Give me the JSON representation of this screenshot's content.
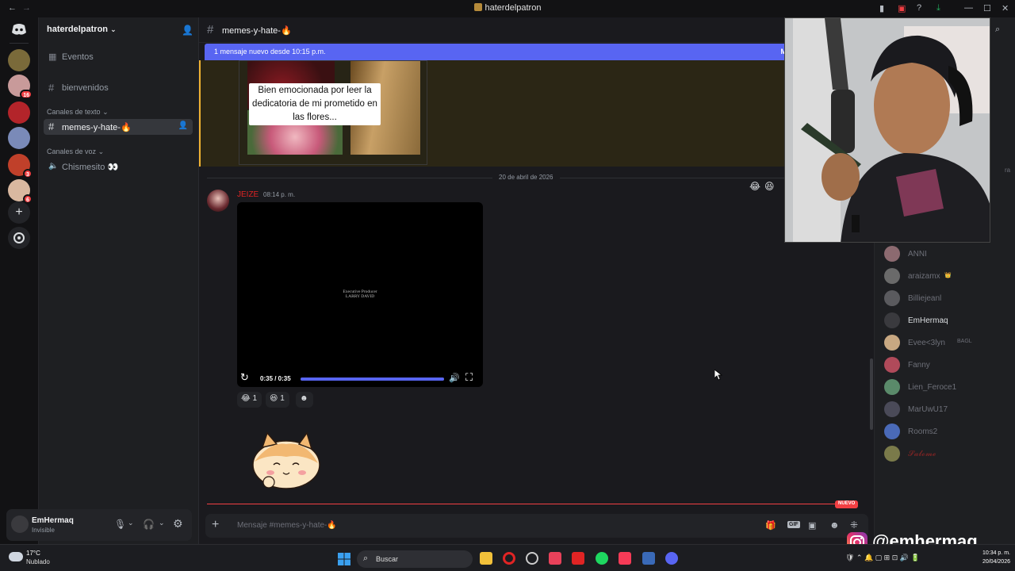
{
  "window": {
    "title": "haterdelpatron"
  },
  "server": {
    "name": "haterdelpatron"
  },
  "sidebar": {
    "events_label": "Eventos",
    "channels_top": [
      {
        "label": "bienvenidos"
      }
    ],
    "text_category": "Canales de texto",
    "text_channels": [
      {
        "label": "memes-y-hate-🔥",
        "active": true
      }
    ],
    "voice_category": "Canales de voz",
    "voice_channels": [
      {
        "label": "Chismesito 👀"
      }
    ]
  },
  "servers": [
    {
      "color": "#7a6a3a",
      "badge": ""
    },
    {
      "color": "#c89a9a",
      "badge": "16"
    },
    {
      "color": "#b3242a",
      "badge": ""
    },
    {
      "color": "#7a8ab8",
      "badge": ""
    },
    {
      "color": "#c0402a",
      "badge": "3"
    },
    {
      "color": "#d9b8a0",
      "badge": "6"
    }
  ],
  "channel": {
    "name": "memes-y-hate-🔥",
    "new_messages_bar": "1 mensaje nuevo desde 10:15 p.m.",
    "new_messages_bar_right": "M"
  },
  "meme": {
    "caption": "Bien emocionada por leer la dedicatoria de mi prometido en las flores..."
  },
  "date_divider": "20 de abril de 2026",
  "message": {
    "author": "JEIZE",
    "author_color": "#e02424",
    "time": "08:14 p. m.",
    "video": {
      "overlay_line1": "Executive Producer",
      "overlay_line2": "LARRY DAVID",
      "time_display": "0:35 / 0:35",
      "progress": 1.0
    },
    "reactions": [
      {
        "emoji": "😂",
        "count": "1"
      },
      {
        "emoji": "😆",
        "count": "1"
      }
    ]
  },
  "new_label": "NUEVO",
  "composer": {
    "placeholder": "Mensaje #memes-y-hate-🔥"
  },
  "user_panel": {
    "name": "EmHermaq",
    "status": "Invisible"
  },
  "members": [
    {
      "name": "ANNI",
      "color": "#8c6a70",
      "extra": ""
    },
    {
      "name": "araizamx",
      "color": "#6a6a6a",
      "extra": "👑"
    },
    {
      "name": "Billiejeanl",
      "color": "#5a5a5e",
      "extra": ""
    },
    {
      "name": "EmHermaq",
      "color": "#3a3a3e",
      "extra": "",
      "active": true
    },
    {
      "name": "Evee<3lyn",
      "color": "#c8a882",
      "extra": "BAGL"
    },
    {
      "name": "Fanny",
      "color": "#b04a5a",
      "extra": ""
    },
    {
      "name": "Lien_Feroce1",
      "color": "#5a8a6a",
      "extra": ""
    },
    {
      "name": "MarUwU17",
      "color": "#4a4a58",
      "extra": ""
    },
    {
      "name": "Rooms2",
      "color": "#4a6ab8",
      "extra": ""
    },
    {
      "name": "𝓢𝓪𝓵𝓸𝓶𝓮",
      "color": "#7a7a4a",
      "extra": "",
      "red": true
    }
  ],
  "members_partial_label": "ra",
  "overlay": {
    "handle": "@emhermaq"
  },
  "taskbar": {
    "weather_temp": "17°C",
    "weather_desc": "Nublado",
    "search_label": "Buscar",
    "clock_time": "10:34 p. m.",
    "clock_date": "20/04/2026"
  },
  "colors": {
    "accent": "#5865f2",
    "highlight_border": "#f0b232",
    "new_red": "#f23f43"
  }
}
